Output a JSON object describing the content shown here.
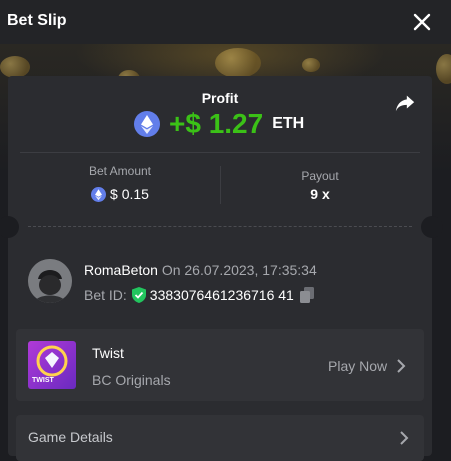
{
  "header": {
    "title": "Bet Slip"
  },
  "profit": {
    "label": "Profit",
    "value": "+$ 1.27",
    "unit": "ETH"
  },
  "bet_amount": {
    "label": "Bet Amount",
    "value": "$ 0.15"
  },
  "payout": {
    "label": "Payout",
    "value": "9 x"
  },
  "user": {
    "name": "RomaBeton",
    "date": "On 26.07.2023, 17:35:34"
  },
  "bet": {
    "label": "Bet ID:",
    "id": "3383076461236716 41"
  },
  "game": {
    "name": "Twist",
    "category": "BC Originals",
    "action": "Play Now",
    "thumb_text": "TWIST"
  },
  "details": {
    "label": "Game Details"
  },
  "colors": {
    "profit_green": "#3bc117",
    "eth_blue": "#627eea",
    "shield_green": "#22c55e"
  },
  "icons": [
    "close-icon",
    "share-icon",
    "eth-icon",
    "shield-check-icon",
    "copy-icon",
    "chevron-right-icon"
  ]
}
